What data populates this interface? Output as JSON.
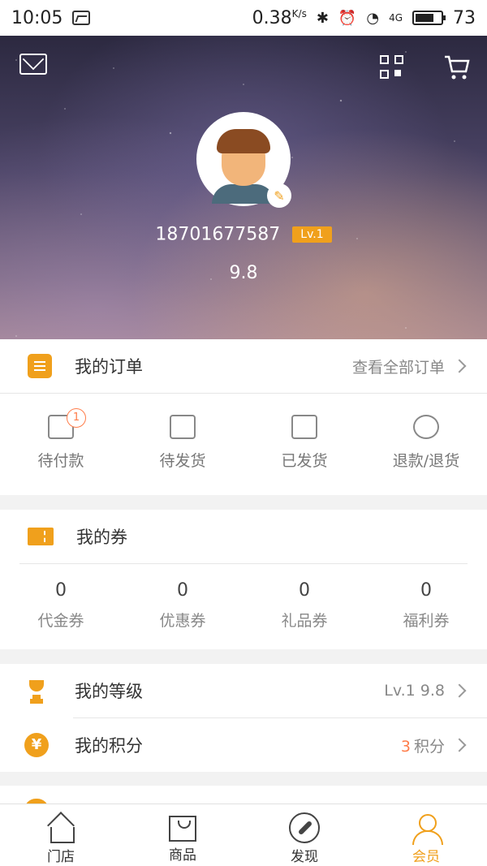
{
  "status_bar": {
    "time": "10:05",
    "speed": "0.38",
    "speed_unit": "K/s",
    "network": "4G",
    "battery": "73"
  },
  "profile": {
    "phone": "18701677587",
    "level_badge": "Lv.1",
    "score": "9.8"
  },
  "orders": {
    "title": "我的订单",
    "view_all": "查看全部订单",
    "items": [
      {
        "label": "待付款",
        "badge": "1",
        "icon": "wallet-icon"
      },
      {
        "label": "待发货",
        "icon": "package-icon"
      },
      {
        "label": "已发货",
        "icon": "truck-icon"
      },
      {
        "label": "退款/退货",
        "icon": "refund-icon"
      }
    ]
  },
  "coupons": {
    "title": "我的券",
    "items": [
      {
        "count": "0",
        "label": "代金券"
      },
      {
        "count": "0",
        "label": "优惠券"
      },
      {
        "count": "0",
        "label": "礼品券"
      },
      {
        "count": "0",
        "label": "福利券"
      }
    ]
  },
  "level": {
    "title": "我的等级",
    "value": "Lv.1 9.8"
  },
  "points": {
    "title": "我的积分",
    "count": "3",
    "unit": "积分"
  },
  "nav": {
    "items": [
      {
        "label": "门店",
        "icon": "home-icon"
      },
      {
        "label": "商品",
        "icon": "bag-icon"
      },
      {
        "label": "发现",
        "icon": "compass-icon"
      },
      {
        "label": "会员",
        "icon": "user-icon",
        "active": true
      }
    ]
  },
  "colors": {
    "accent": "#f0a01c",
    "highlight": "#ff7d4a"
  }
}
